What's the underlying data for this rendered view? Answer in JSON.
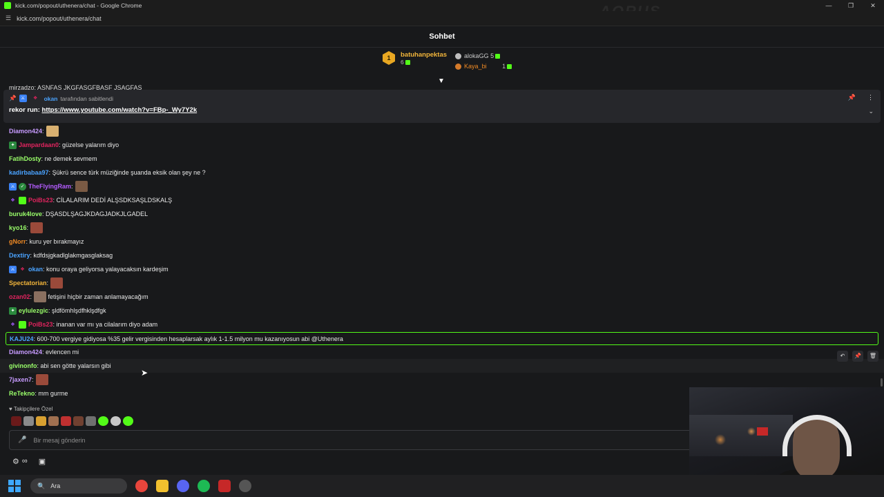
{
  "window": {
    "title": "kick.com/popout/uthenera/chat - Google Chrome",
    "url": "kick.com/popout/uthenera/chat",
    "watermark": "AORUS"
  },
  "chat": {
    "title": "Sohbet"
  },
  "leaderboard": {
    "first": {
      "rank": "1",
      "name": "batuhanpektas",
      "count": "6"
    },
    "second": {
      "name": "alokaGG",
      "count": "5"
    },
    "third": {
      "name": "Kaya_bi",
      "count": "1"
    }
  },
  "peek_line": "mirzadzo: ASNFAS JKGFASGFBASF JSAGFAS",
  "pinned": {
    "pinner": "okan",
    "pinned_by_text": "tarafından sabitlendi",
    "prefix": "rekor run: ",
    "link": "https://www.youtube.com/watch?v=FBp-_Wy7Y2k"
  },
  "messages": [
    {
      "user": "Diamon424",
      "color": "#c79bff",
      "text": ""
    },
    {
      "user": "Jampardaan0",
      "color": "#e0245e",
      "text": "güzelse yalarım diyo"
    },
    {
      "user": "FatihDosty",
      "color": "#9aff6a",
      "text": "ne demek sevmem"
    },
    {
      "user": "kadirbabaa97",
      "color": "#4aa3ff",
      "text": "Şükrü sence türk müziğinde şuanda eksik olan şey ne ?"
    },
    {
      "user": "TheFlyingRam",
      "color": "#b45cff",
      "text": ""
    },
    {
      "user": "PoiBs23",
      "color": "#e0245e",
      "text": "CİLALARIM DEDİ ALŞSDKSAŞLDSKALŞ"
    },
    {
      "user": "buruk4love",
      "color": "#9aff6a",
      "text": "DŞASDLŞAGJKDAGJADKJLGADEL"
    },
    {
      "user": "kyo16",
      "color": "#9aff6a",
      "text": ""
    },
    {
      "user": "gNorr",
      "color": "#f08a24",
      "text": "kuru yer bırakmayız"
    },
    {
      "user": "Dextiry",
      "color": "#4aa3ff",
      "text": "kdfdsjgkadlglakmgasglaksag"
    },
    {
      "user": "okan",
      "color": "#4aa3ff",
      "text": "konu oraya geliyorsa yalayacaksın kardeşim"
    },
    {
      "user": "Spectatorian",
      "color": "#f2b53a",
      "text": ""
    },
    {
      "user": "ozan02",
      "color": "#e0245e",
      "text": "fetişini hiçbir zaman anlamayacağım"
    },
    {
      "user": "eylulezgic",
      "color": "#9aff6a",
      "text": "şldfömhlşdfhklşdfgk"
    },
    {
      "user": "PoiBs23",
      "color": "#e0245e",
      "text": "inanan var mı ya cilalarım diyo adam"
    },
    {
      "user": "KAJU24",
      "color": "#4aa3ff",
      "text": "600-700 vergiye gidiyosa %35 gelir vergisinden hesaplarsak aylık 1-1.5 milyon mu kazanıyosun abi @Uthenera"
    },
    {
      "user": "Diamon424",
      "color": "#c79bff",
      "text": "evlencen mi"
    },
    {
      "user": "givinonfo",
      "color": "#9aff6a",
      "text": "abi sen götte yalarsın gibi"
    },
    {
      "user": "7jaxen7",
      "color": "#c79bff",
      "text": ""
    },
    {
      "user": "ReTekno",
      "color": "#9aff6a",
      "text": "mm gurme"
    }
  ],
  "followers_label": "Takipçilere Özel",
  "input": {
    "placeholder": "Bir mesaj gönderin"
  },
  "taskbar": {
    "search_label": "Ara"
  }
}
